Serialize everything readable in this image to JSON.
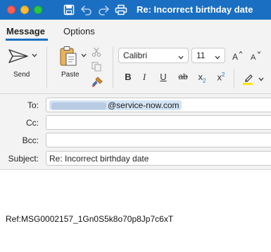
{
  "window": {
    "title": "Re: Incorrect birthday date"
  },
  "tabs": [
    {
      "label": "Message",
      "active": true
    },
    {
      "label": "Options",
      "active": false
    }
  ],
  "ribbon": {
    "send_label": "Send",
    "paste_label": "Paste",
    "font_name": "Calibri",
    "font_size": "11",
    "format_buttons": [
      "B",
      "I",
      "U",
      "ab",
      "x",
      "x"
    ]
  },
  "header": {
    "to_label": "To:",
    "to_value": "@service-now.com",
    "cc_label": "Cc:",
    "cc_value": "",
    "bcc_label": "Bcc:",
    "bcc_value": "",
    "subject_label": "Subject:",
    "subject_value": "Re: Incorrect birthday date"
  },
  "body": {
    "ref_line": "Ref:MSG0002157_1Gn0S5k8o70p8Jp7c6xT"
  },
  "colors": {
    "titlebar": "#1a6fc2",
    "accent": "#1a6fc2",
    "highlight": "#ffe600"
  }
}
